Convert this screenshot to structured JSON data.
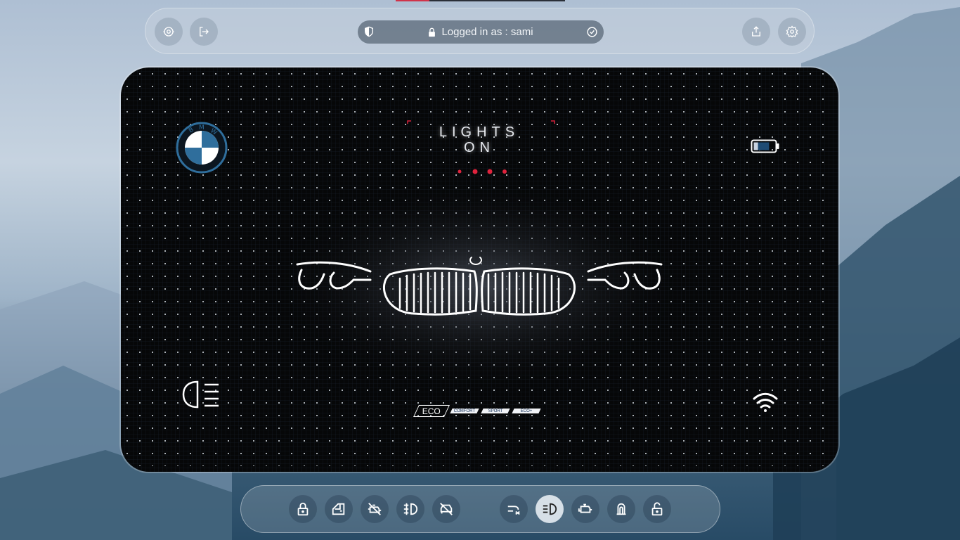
{
  "top_bar": {
    "session_text": "Logged in as : sami",
    "icons": [
      "camera-switch-icon",
      "logout-icon",
      "shield-icon",
      "lock-icon",
      "check-circle-icon",
      "share-icon",
      "gear-icon"
    ]
  },
  "dashboard": {
    "brand": "BMW",
    "status_title": "LIGHTS",
    "status_subtitle": "ON",
    "battery_level": 0.75,
    "drive_modes": [
      {
        "label": "ECO",
        "active": true
      },
      {
        "label": "COMFORT",
        "active": false
      },
      {
        "label": "SPORT",
        "active": false
      },
      {
        "label": "ECO+",
        "active": false
      }
    ],
    "colors": {
      "accent_red": "#e0233d",
      "logo_blue": "#2f6e9c",
      "glow_white": "#ffffff"
    }
  },
  "bottom_bar": {
    "buttons": [
      {
        "name": "lock-icon",
        "active": false
      },
      {
        "name": "car-door-icon",
        "active": false
      },
      {
        "name": "engine-off-icon",
        "active": false
      },
      {
        "name": "fog-light-icon",
        "active": false
      },
      {
        "name": "car-off-icon",
        "active": false
      },
      {
        "name": "wiper-icon",
        "active": false
      },
      {
        "name": "headlight-icon",
        "active": true
      },
      {
        "name": "engine-icon",
        "active": false
      },
      {
        "name": "seatbelt-icon",
        "active": false
      },
      {
        "name": "unlock-icon",
        "active": false
      }
    ]
  }
}
